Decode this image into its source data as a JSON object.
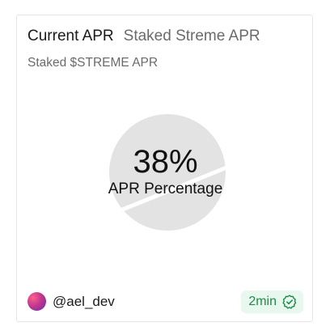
{
  "header": {
    "tab_active": "Current APR",
    "tab_inactive": "Staked Streme APR"
  },
  "subtitle": "Staked $STREME APR",
  "chart_data": {
    "type": "pie",
    "value_percent": 38,
    "value_text": "38%",
    "label": "APR Percentage",
    "colors": {
      "fill": "#e3e3e3",
      "gap": "#ffffff",
      "text": "#111111"
    }
  },
  "footer": {
    "author": "@ael_dev",
    "time": "2min",
    "verified_icon": "verified-badge-icon",
    "badge_color": "#1f8a4c",
    "badge_bg": "#e9f8ee"
  }
}
